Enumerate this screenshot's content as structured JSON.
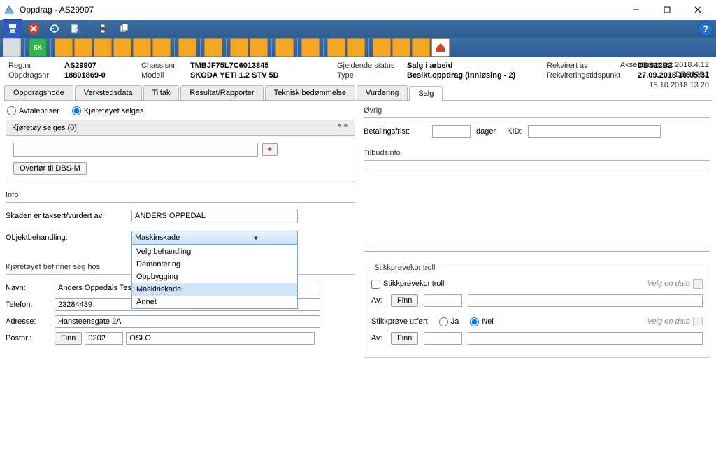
{
  "window": {
    "title": "Oppdrag - AS29907"
  },
  "summary": {
    "regnr_label": "Reg.nr",
    "regnr": "AS29907",
    "chassisnr_label": "Chassisnr",
    "chassisnr": "TMBJF75L7C6013845",
    "gjeldende_status_label": "Gjeldende status",
    "gjeldende_status": "Salg i arbeid",
    "rekvirert_av_label": "Rekvirert av",
    "rekvirert_av": "DBS12B2",
    "oppdragsnr_label": "Oppdragsnr",
    "oppdragsnr": "18801869-0",
    "modell_label": "Modell",
    "modell": "SKODA YETI 1.2 STV 5D",
    "type_label": "Type",
    "type": "Besikt.oppdrag (Innløsing - 2)",
    "rekv_tid_label": "Rekvireringstidspunkt",
    "rekv_tid": "27.09.2018 10:05:31",
    "meta1": "Akseptansetest 2018.4.12",
    "meta2": "DBS12B2",
    "meta3": "15.10.2018 13.20"
  },
  "tabs": [
    "Oppdragshode",
    "Verkstedsdata",
    "Tiltak",
    "Resultat/Rapporter",
    "Teknisk bedømmelse",
    "Vurdering",
    "Salg"
  ],
  "active_tab": "Salg",
  "radios": {
    "avtalepriser": "Avtalepriser",
    "selges": "Kjøretøyet selges"
  },
  "panel_selges_title": "Kjøretøy selges (0)",
  "overfor_btn": "Overfør til DBS-M",
  "info_title": "Info",
  "info": {
    "taksert_label": "Skaden er taksert/vurdert av:",
    "taksert_value": "ANDERS OPPEDAL",
    "objekt_label": "Objektbehandling:",
    "objekt_value": "Maskinskade",
    "objekt_options": [
      "Velg behandling",
      "Demontering",
      "Oppbygging",
      "Maskinskade",
      "Annet"
    ],
    "befinner_title": "Kjøretøyet befinner seg hos",
    "navn_label": "Navn:",
    "navn": "Anders Oppedals Testverkst",
    "telefon_label": "Telefon:",
    "telefon": "23284439",
    "adresse_label": "Adresse:",
    "adresse": "Hansteensgate 2A",
    "postnr_label": "Postnr.:",
    "postnr": "0202",
    "poststed": "OSLO",
    "finn_btn": "Finn"
  },
  "ovrig": {
    "title": "Øvrig",
    "betalingsfrist_label": "Betalingsfrist:",
    "dager_label": "dager",
    "kid_label": "KID:"
  },
  "tilbud": {
    "title": "Tilbudsinfo"
  },
  "stikkprove": {
    "legend": "Stikkprøvekontroll",
    "chk_label": "Stikkprøvekontroll",
    "velg_dato": "Velg en dato",
    "av_label": "Av:",
    "finn_btn": "Finn",
    "utfort_label": "Stikkprøve utført",
    "ja": "Ja",
    "nei": "Nei"
  }
}
